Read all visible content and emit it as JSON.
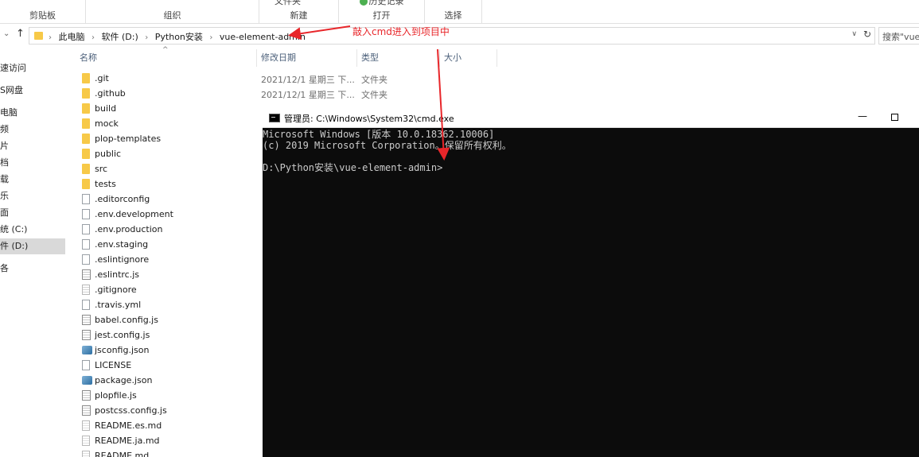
{
  "ribbon": {
    "groups": [
      {
        "label": "剪贴板",
        "top": ""
      },
      {
        "label": "组织",
        "top": ""
      },
      {
        "label": "新建",
        "top": "文件夹"
      },
      {
        "label": "打开",
        "top": "历史记录"
      },
      {
        "label": "选择",
        "top": ""
      }
    ]
  },
  "address": {
    "breadcrumbs": [
      "此电脑",
      "软件 (D:)",
      "Python安装",
      "vue-element-admin"
    ],
    "search_placeholder": "搜索\"vue"
  },
  "columns": {
    "name": "名称",
    "date": "修改日期",
    "type": "类型",
    "size": "大小"
  },
  "navpane": {
    "items": [
      "速访问",
      "S网盘",
      "电脑",
      "频",
      "片",
      "档",
      "载",
      "乐",
      "面",
      "统 (C:)",
      "件 (D:)",
      "各"
    ]
  },
  "files": [
    {
      "name": ".git",
      "kind": "folder",
      "date": "2021/12/1 星期三 下...",
      "type": "文件夹"
    },
    {
      "name": ".github",
      "kind": "folder",
      "date": "2021/12/1 星期三 下...",
      "type": "文件夹"
    },
    {
      "name": "build",
      "kind": "folder",
      "date": "",
      "type": ""
    },
    {
      "name": "mock",
      "kind": "folder",
      "date": "",
      "type": ""
    },
    {
      "name": "plop-templates",
      "kind": "folder",
      "date": "",
      "type": ""
    },
    {
      "name": "public",
      "kind": "folder",
      "date": "",
      "type": ""
    },
    {
      "name": "src",
      "kind": "folder",
      "date": "",
      "type": ""
    },
    {
      "name": "tests",
      "kind": "folder",
      "date": "",
      "type": ""
    },
    {
      "name": ".editorconfig",
      "kind": "file",
      "date": "",
      "type": ""
    },
    {
      "name": ".env.development",
      "kind": "file",
      "date": "",
      "type": ""
    },
    {
      "name": ".env.production",
      "kind": "file",
      "date": "",
      "type": ""
    },
    {
      "name": ".env.staging",
      "kind": "file",
      "date": "",
      "type": ""
    },
    {
      "name": ".eslintignore",
      "kind": "file",
      "date": "",
      "type": ""
    },
    {
      "name": ".eslintrc.js",
      "kind": "js",
      "date": "",
      "type": ""
    },
    {
      "name": ".gitignore",
      "kind": "txt",
      "date": "",
      "type": ""
    },
    {
      "name": ".travis.yml",
      "kind": "file",
      "date": "",
      "type": ""
    },
    {
      "name": "babel.config.js",
      "kind": "js",
      "date": "",
      "type": ""
    },
    {
      "name": "jest.config.js",
      "kind": "js",
      "date": "",
      "type": ""
    },
    {
      "name": "jsconfig.json",
      "kind": "json",
      "date": "",
      "type": ""
    },
    {
      "name": "LICENSE",
      "kind": "file",
      "date": "",
      "type": ""
    },
    {
      "name": "package.json",
      "kind": "json",
      "date": "",
      "type": ""
    },
    {
      "name": "plopfile.js",
      "kind": "js",
      "date": "",
      "type": ""
    },
    {
      "name": "postcss.config.js",
      "kind": "js",
      "date": "",
      "type": ""
    },
    {
      "name": "README.es.md",
      "kind": "md",
      "date": "",
      "type": ""
    },
    {
      "name": "README.ja.md",
      "kind": "md",
      "date": "",
      "type": ""
    },
    {
      "name": "README.md",
      "kind": "md",
      "date": "",
      "type": ""
    }
  ],
  "cmd": {
    "title": "管理员: C:\\Windows\\System32\\cmd.exe",
    "lines": [
      "Microsoft Windows [版本 10.0.18362.10006]",
      "(c) 2019 Microsoft Corporation。保留所有权利。",
      "",
      "D:\\Python安装\\vue-element-admin>"
    ]
  },
  "annotation": {
    "text": "敲入cmd进入到项目中",
    "color": "#e8262a"
  }
}
